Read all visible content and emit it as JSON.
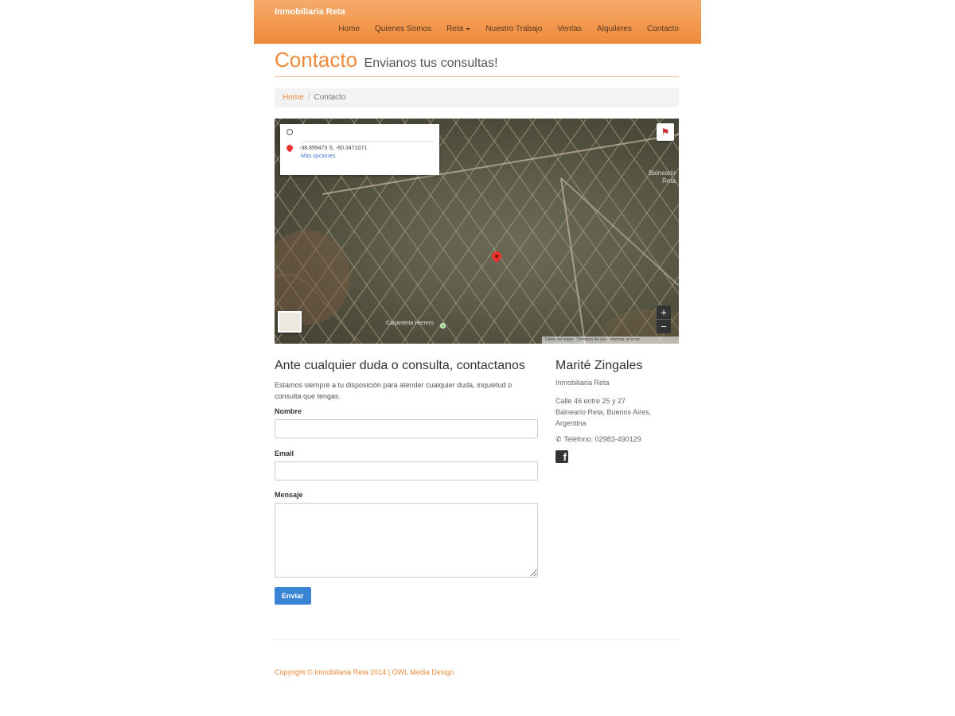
{
  "navbar": {
    "brand": "Inmobiliaria Reta",
    "items": [
      {
        "label": "Home"
      },
      {
        "label": "Quienes Somos"
      },
      {
        "label": "Reta",
        "dropdown": true
      },
      {
        "label": "Nuestro Trabajo"
      },
      {
        "label": "Ventas"
      },
      {
        "label": "Alquileres"
      },
      {
        "label": "Contacto"
      }
    ]
  },
  "header": {
    "title": "Contacto",
    "subtitle": "Envianos tus consultas!"
  },
  "breadcrumb": {
    "home": "Home",
    "current": "Contacto"
  },
  "map": {
    "info_coords": "-38.899473 S, -60.3471071",
    "info_link": "Más opciones",
    "place_label": "Balneario\nReta",
    "road_label": "Carpinteria Herrero",
    "attribution": "Datos del mapa · Términos de uso · Informar un error",
    "zoom_in": "+",
    "zoom_out": "−"
  },
  "form": {
    "title": "Ante cualquier duda o consulta, contactanos",
    "description": "Estamos siempre a tu disposición para atender cualquier duda, inquietud o consulta que tengas.",
    "name_label": "Nombre",
    "email_label": "Email",
    "message_label": "Mensaje",
    "submit_label": "Enviar"
  },
  "contact": {
    "name": "Marité Zingales",
    "company": "Inmobiliaria Reta",
    "address": "Calle 46 entre 25 y 27\nBalneario Reta, Buenos Aires, Argentina",
    "phone": "Teléfono: 02983-490129"
  },
  "footer": {
    "copyright": "Copyright © Inmobiliaria Reta 2014",
    "separator": "|",
    "credit": "OWL Media Design"
  },
  "colors": {
    "accent": "#ee8a3a",
    "button": "#3a84d6"
  },
  "icons": {
    "phone": "phone-icon",
    "facebook": "facebook-icon",
    "map_pin": "map-pin-icon"
  }
}
